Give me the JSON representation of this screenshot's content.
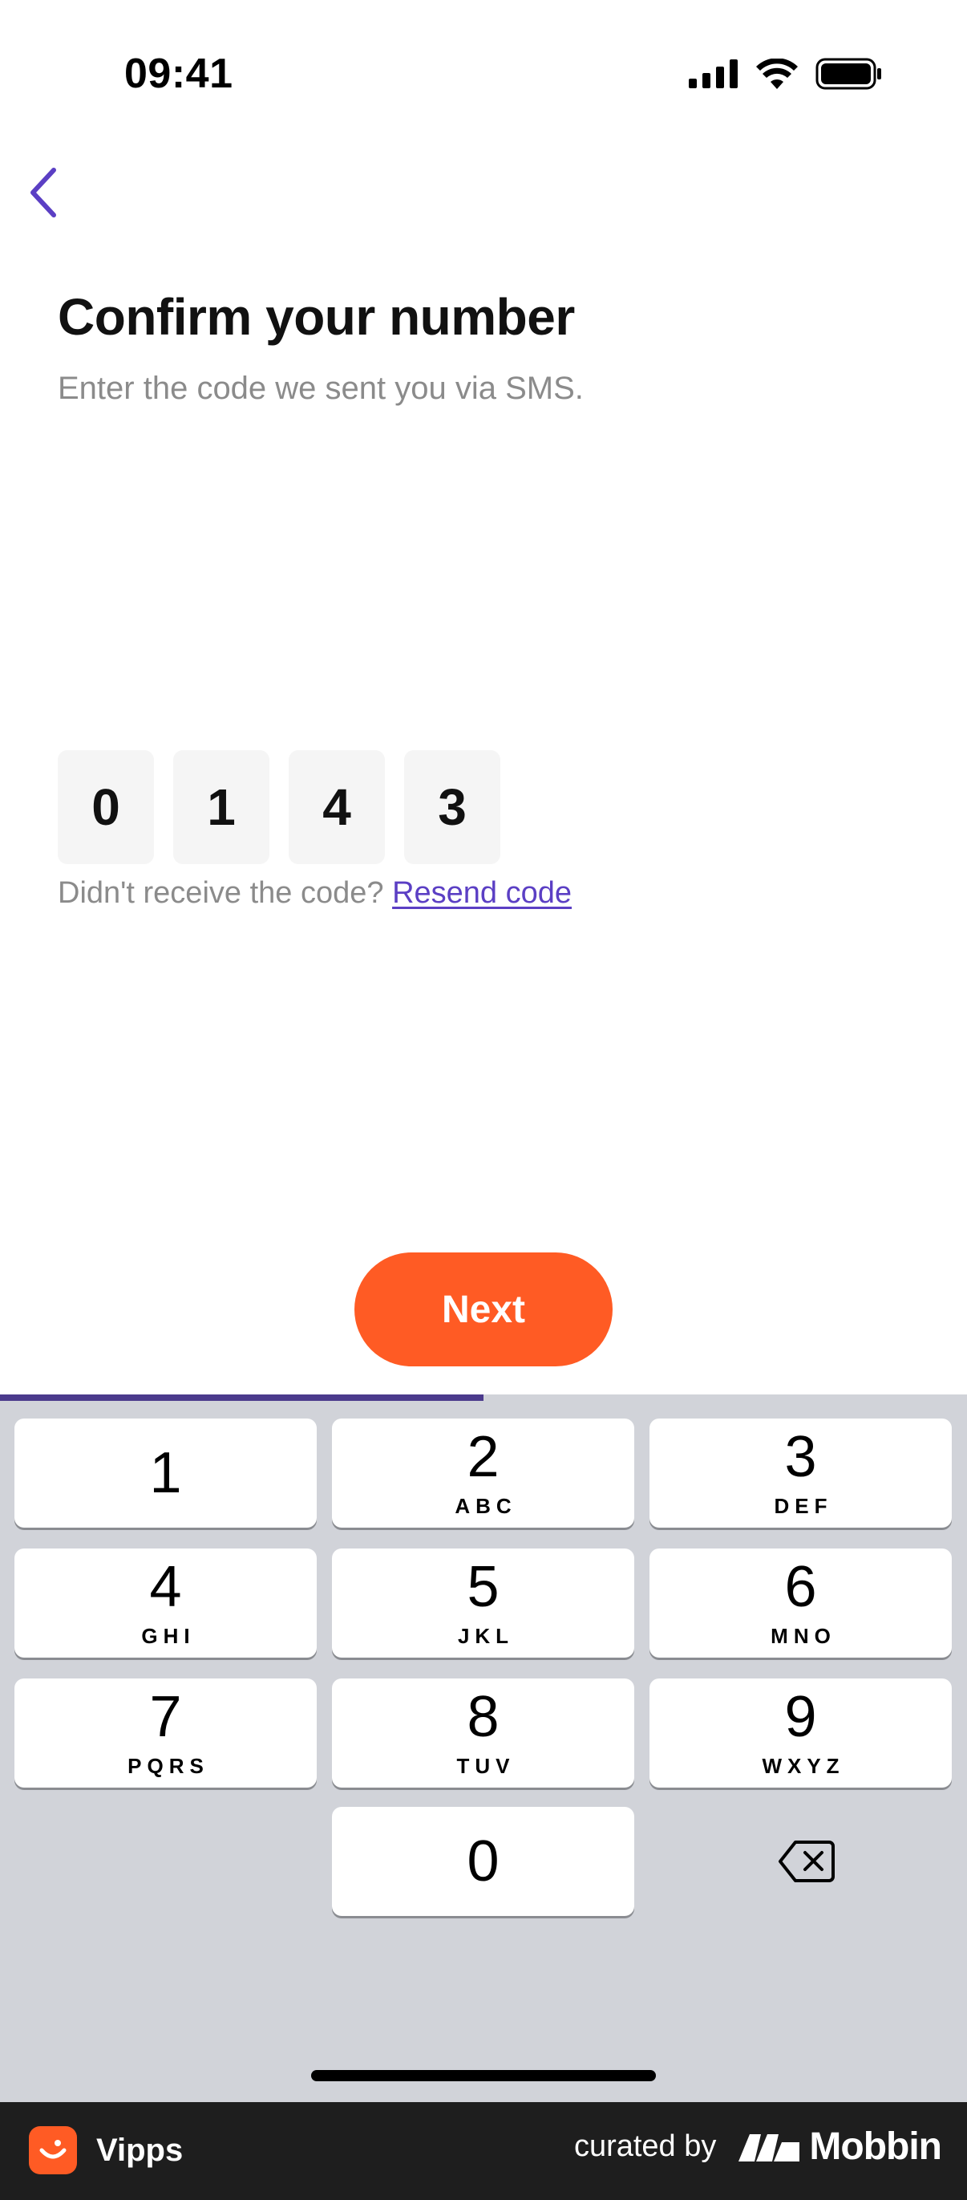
{
  "status_bar": {
    "time": "09:41"
  },
  "header": {
    "back_icon": "chevron-left-icon",
    "title": "Confirm your number",
    "subtitle": "Enter the code we sent you via SMS."
  },
  "code": {
    "digits": [
      "0",
      "1",
      "4",
      "3"
    ]
  },
  "resend": {
    "prompt": "Didn't receive the code?",
    "link_label": "Resend code"
  },
  "next_button": {
    "label": "Next"
  },
  "progress": {
    "fraction": 0.5
  },
  "keypad": {
    "keys": [
      {
        "digit": "1",
        "letters": ""
      },
      {
        "digit": "2",
        "letters": "ABC"
      },
      {
        "digit": "3",
        "letters": "DEF"
      },
      {
        "digit": "4",
        "letters": "GHI"
      },
      {
        "digit": "5",
        "letters": "JKL"
      },
      {
        "digit": "6",
        "letters": "MNO"
      },
      {
        "digit": "7",
        "letters": "PQRS"
      },
      {
        "digit": "8",
        "letters": "TUV"
      },
      {
        "digit": "9",
        "letters": "WXYZ"
      },
      {
        "digit": "0",
        "letters": ""
      }
    ],
    "delete_icon": "backspace-icon"
  },
  "footer": {
    "app_name": "Vipps",
    "curated_label": "curated by",
    "brand_name": "Mobbin"
  },
  "colors": {
    "accent": "#ff5b24",
    "link": "#5b3fc4",
    "progress": "#4b3a8c",
    "keypad_bg": "#d1d3d9",
    "footer_bg": "#1e1e1e"
  }
}
